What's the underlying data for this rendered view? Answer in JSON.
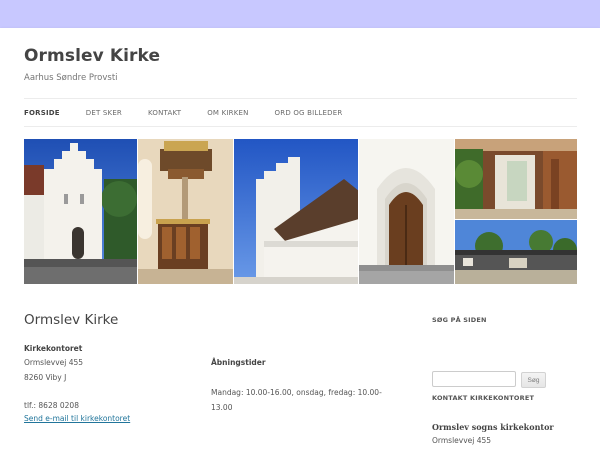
{
  "site": {
    "title": "Ormslev Kirke",
    "description": "Aarhus Søndre Provsti"
  },
  "nav": {
    "items": [
      {
        "label": "FORSIDE",
        "current": true
      },
      {
        "label": "DET SKER",
        "current": false
      },
      {
        "label": "KONTAKT",
        "current": false
      },
      {
        "label": "OM KIRKEN",
        "current": false
      },
      {
        "label": "ORD OG BILLEDER",
        "current": false
      }
    ]
  },
  "content": {
    "title": "Ormslev Kirke",
    "office_heading": "Kirkekontoret",
    "address_line1": "Ormslevvej 455",
    "address_line2": "8260 Viby J",
    "phone": "tlf.: 8628 0208",
    "email_link": "Send e-mail til kirkekontoret",
    "hours_heading": "Åbningstider",
    "hours_text": "Mandag: 10.00-16.00, onsdag, fredag: 10.00-13.00"
  },
  "sidebar": {
    "search_title": "SØG PÅ SIDEN",
    "search_value": "",
    "search_button": "Søg",
    "contact_title": "KONTAKT KIRKEKONTORET",
    "contact_name": "Ormslev sogns kirkekontor",
    "contact_address": "Ormslevvej 455"
  },
  "colors": {
    "background": "#c8c8ff",
    "link": "#21759b",
    "text": "#444444"
  }
}
